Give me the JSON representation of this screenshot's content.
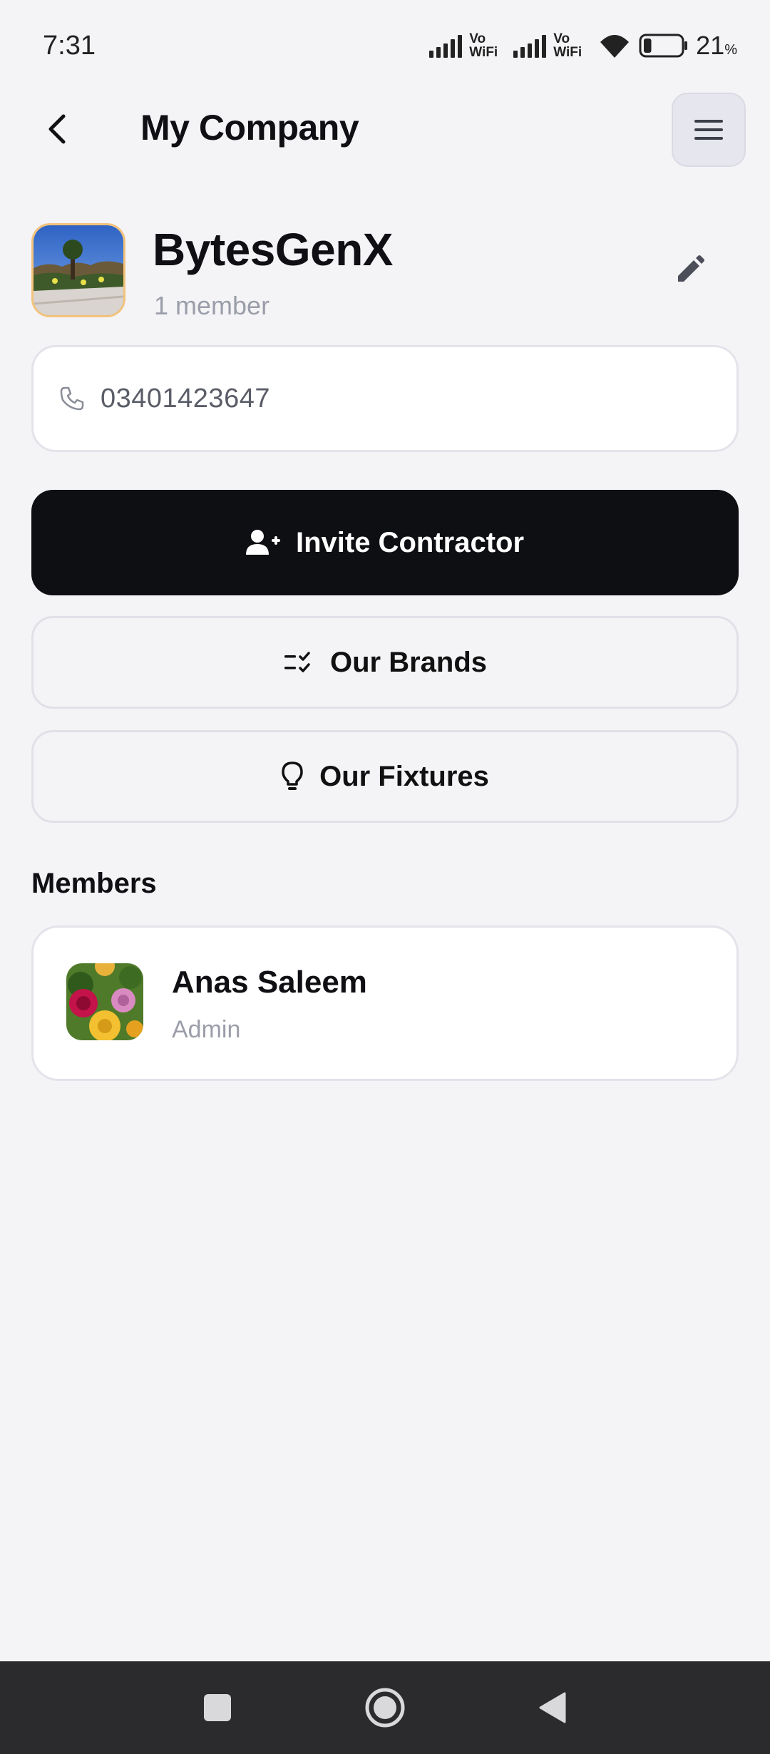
{
  "status_bar": {
    "time": "7:31",
    "network_label_1": "Vo\nWiFi",
    "network_label_2": "Vo\nWiFi",
    "battery_level": "21",
    "battery_unit": "%",
    "battery_fraction": 0.21
  },
  "header": {
    "title": "My Company",
    "back_icon": "chevron-left-icon",
    "menu_icon": "hamburger-menu-icon"
  },
  "company": {
    "name": "BytesGenX",
    "member_count": "1 member",
    "edit_icon": "pencil-icon"
  },
  "phone": {
    "icon": "phone-icon",
    "value": "03401423647"
  },
  "actions": {
    "invite_label": "Invite Contractor",
    "invite_icon": "user-plus-icon",
    "brands_label": "Our Brands",
    "brands_icon": "list-check-icon",
    "fixtures_label": "Our Fixtures",
    "fixtures_icon": "lightbulb-icon"
  },
  "members": {
    "heading": "Members",
    "items": [
      {
        "name": "Anas Saleem",
        "role": "Admin"
      }
    ]
  },
  "nav": {
    "recents_icon": "square-icon",
    "home_icon": "circle-icon",
    "back_icon": "triangle-back-icon"
  },
  "colors": {
    "background": "#f4f4f7",
    "primary_button": "#0e0f13",
    "muted_text": "#9b9ea9",
    "nav_bar": "#2b2b2d"
  }
}
